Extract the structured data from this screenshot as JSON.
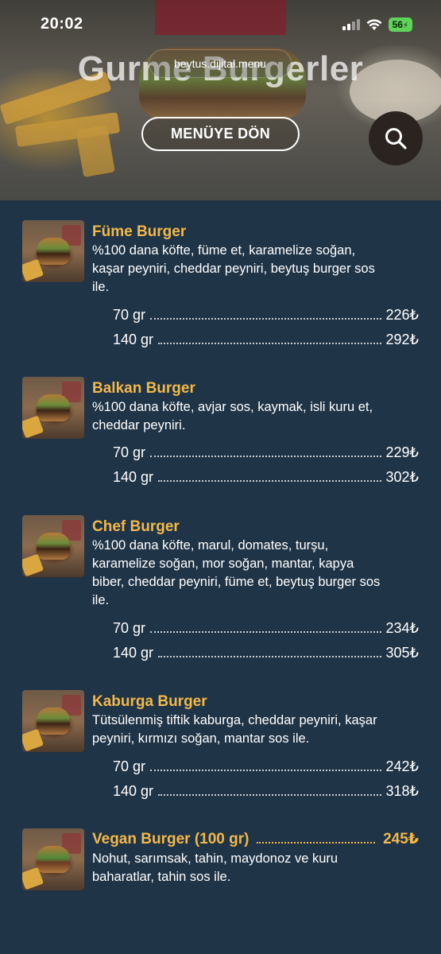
{
  "status_bar": {
    "time": "20:02",
    "battery": "56"
  },
  "header": {
    "url": "beytus.dijital.menu",
    "title": "Gurme Burgerler",
    "back_button": "MENÜYE DÖN"
  },
  "currency": "₺",
  "items": [
    {
      "name": "Füme Burger",
      "desc_lines": [
        "%100 dana köfte, füme et, karamelize soğan,",
        "kaşar peyniri, cheddar peyniri, beytuş burger sos",
        "ile."
      ],
      "prices": [
        {
          "size": "70 gr",
          "price": "226₺"
        },
        {
          "size": "140 gr",
          "price": "292₺"
        }
      ]
    },
    {
      "name": "Balkan Burger",
      "desc_lines": [
        "%100 dana köfte, avjar sos, kaymak, isli kuru et,",
        "cheddar peyniri."
      ],
      "prices": [
        {
          "size": "70 gr",
          "price": "229₺"
        },
        {
          "size": "140 gr",
          "price": "302₺"
        }
      ]
    },
    {
      "name": "Chef Burger",
      "desc_lines": [
        "%100 dana köfte, marul, domates, turşu,",
        "karamelize soğan, mor soğan, mantar, kapya",
        "biber, cheddar peyniri, füme et, beytuş burger sos",
        "ile."
      ],
      "prices": [
        {
          "size": "70 gr",
          "price": "234₺"
        },
        {
          "size": "140 gr",
          "price": "305₺"
        }
      ]
    },
    {
      "name": "Kaburga Burger",
      "desc_lines": [
        "Tütsülenmiş tiftik kaburga, cheddar peyniri, kaşar",
        "peyniri, kırmızı soğan, mantar sos ile."
      ],
      "prices": [
        {
          "size": "70 gr",
          "price": "242₺"
        },
        {
          "size": "140 gr",
          "price": "318₺"
        }
      ]
    },
    {
      "name": "Vegan Burger (100 gr)",
      "price": "245₺",
      "desc_lines": [
        "Nohut, sarımsak, tahin, maydonoz ve kuru",
        "baharatlar, tahin sos ile."
      ]
    }
  ],
  "colors": {
    "background": "#203447",
    "accent": "#f2b84a",
    "text": "#ffffff"
  },
  "icons": {
    "search": "search-icon",
    "wifi": "wifi-icon",
    "signal": "signal-icon",
    "battery": "battery-icon"
  }
}
